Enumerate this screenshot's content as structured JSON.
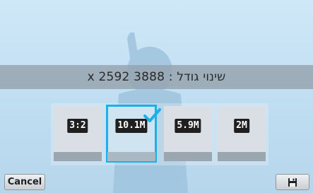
{
  "header": {
    "title": "שינוי גודל : 3888 x 2592"
  },
  "options": [
    {
      "label": "3:2",
      "selected": false
    },
    {
      "label": "10.1M",
      "selected": true
    },
    {
      "label": "5.9M",
      "selected": false
    },
    {
      "label": "2M",
      "selected": false
    }
  ],
  "footer": {
    "cancel_label": "Cancel",
    "save_icon": "save-icon"
  },
  "colors": {
    "accent": "#1bb0ea",
    "title_bar": "#96a5af",
    "background": "#c2dff2"
  }
}
